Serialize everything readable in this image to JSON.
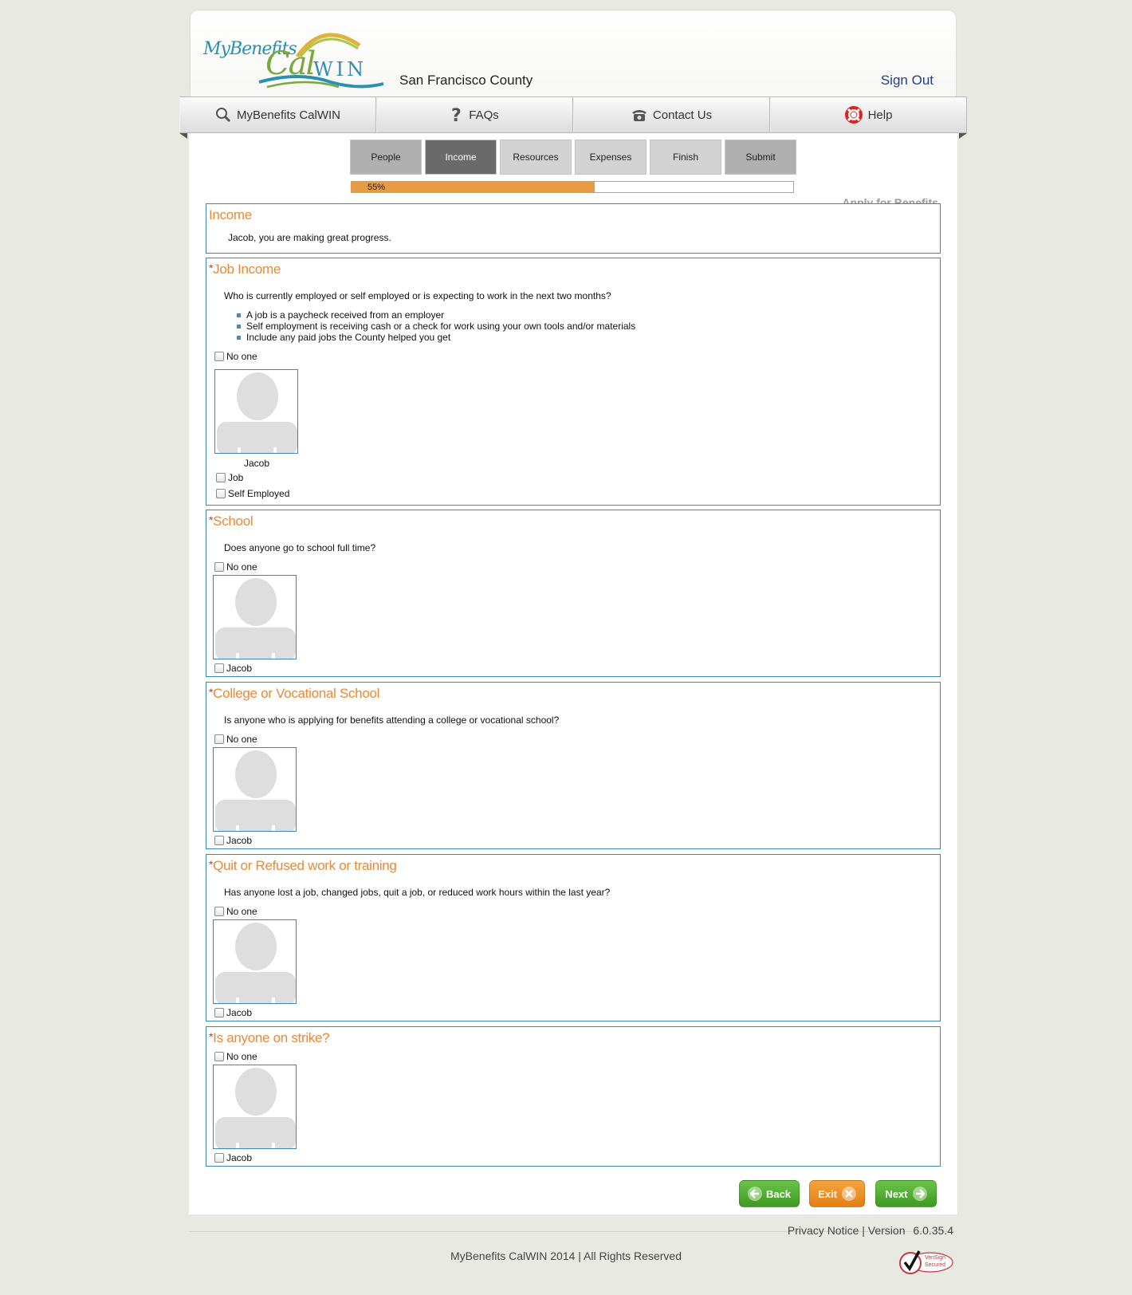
{
  "header": {
    "logo": {
      "my": "My",
      "benefits": "Benefits",
      "cal": "Cal",
      "win": "WIN"
    },
    "county": "San Francisco County",
    "sign_out": "Sign Out"
  },
  "nav": [
    {
      "label": "MyBenefits CalWIN",
      "icon": "search-icon"
    },
    {
      "label": "FAQs",
      "icon": "question-icon"
    },
    {
      "label": "Contact Us",
      "icon": "phone-icon"
    },
    {
      "label": "Help",
      "icon": "lifebuoy-icon"
    }
  ],
  "steps": [
    {
      "label": "People",
      "state": "done"
    },
    {
      "label": "Income",
      "state": "active"
    },
    {
      "label": "Resources",
      "state": "pending"
    },
    {
      "label": "Expenses",
      "state": "pending"
    },
    {
      "label": "Finish",
      "state": "pending"
    },
    {
      "label": "Submit",
      "state": "done"
    }
  ],
  "progress": {
    "percent": 55,
    "label": "55%"
  },
  "page_title": "Apply for Benefits",
  "sections": {
    "income": {
      "title": "Income",
      "message": "Jacob, you are making great progress."
    },
    "job_income": {
      "title": "Job Income",
      "required_marker": "*",
      "question": "Who is currently employed or self employed or is expecting to work in the next two months?",
      "bullets": [
        "A job is a paycheck received from an employer",
        "Self employment is receiving cash or a check for work using your own tools and/or materials",
        "Include any paid jobs the County helped you get"
      ],
      "no_one": "No one",
      "person": "Jacob",
      "options": [
        "Job",
        "Self Employed"
      ]
    },
    "school": {
      "title": "School",
      "required_marker": "*",
      "question": "Does anyone go to school full time?",
      "no_one": "No one",
      "person": "Jacob"
    },
    "college": {
      "title": "College or Vocational School",
      "required_marker": "*",
      "question": "Is anyone who is applying for benefits attending a college or vocational school?",
      "no_one": "No one",
      "person": "Jacob"
    },
    "quit": {
      "title": "Quit or Refused work or training",
      "required_marker": "*",
      "question": "Has anyone lost a job, changed jobs, quit a job, or reduced work hours within the last year?",
      "no_one": "No one",
      "person": "Jacob"
    },
    "strike": {
      "title": "Is anyone on strike?",
      "required_marker": "*",
      "no_one": "No one",
      "person": "Jacob"
    }
  },
  "buttons": {
    "back": "Back",
    "exit": "Exit",
    "next": "Next"
  },
  "footer": {
    "privacy": "Privacy Notice",
    "separator": "|",
    "version_label": "Version",
    "version": "6.0.35.4",
    "copyright": "MyBenefits CalWIN 2014 | All Rights Reserved",
    "verisign_line1": "VeriSign",
    "verisign_line2": "Secured"
  },
  "colors": {
    "section_border": "#3c86b8",
    "section_title": "#e58a3a",
    "progress_fill": "#e89a45",
    "button_green": "#4aa82c",
    "button_orange": "#f0901f"
  }
}
